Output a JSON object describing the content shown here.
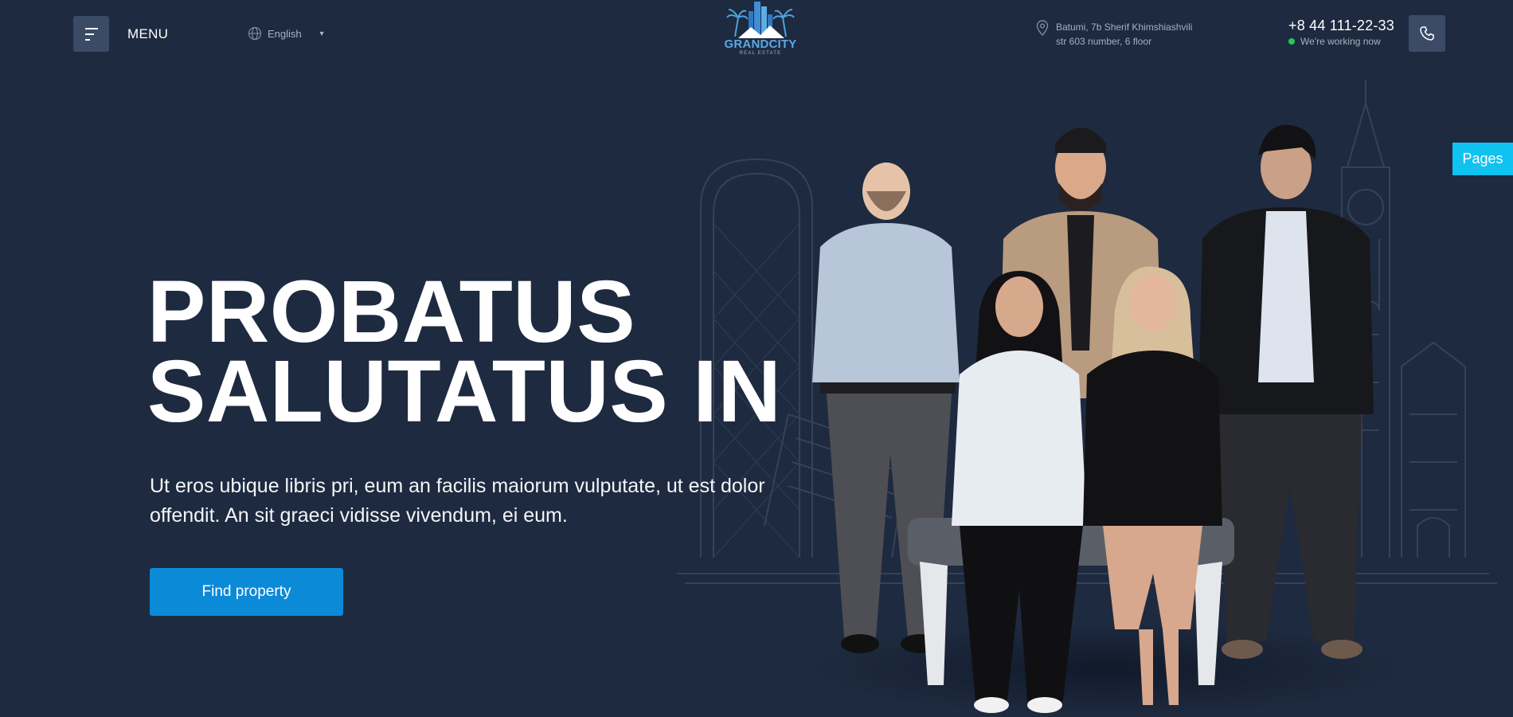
{
  "header": {
    "menu_label": "MENU",
    "language": "English",
    "logo": {
      "name": "GRANDCITY",
      "tagline": "REAL ESTATE"
    },
    "address": {
      "line1": "Batumi, 7b Sherif Khimshiashvili",
      "line2": "str 603 number, 6 floor"
    },
    "phone": {
      "number": "+8 44 111-22-33",
      "status": "We're working now"
    },
    "icons": {
      "menu": "hamburger-icon",
      "language": "globe-icon",
      "address": "location-pin-icon",
      "call": "phone-icon",
      "status": "online-dot"
    }
  },
  "side_tab": {
    "label": "Pages"
  },
  "hero": {
    "title_line1": "PROBATUS",
    "title_line2": "SALUTATUS IN",
    "description": "Ut eros ubique libris pri, eum an facilis maiorum vulputate, ut est dolor offendit. An sit graeci vidisse vivendum, ei eum.",
    "cta_label": "Find property"
  },
  "colors": {
    "background": "#1e2a3f",
    "button_dark": "#3b4b66",
    "accent_blue": "#0b8ad8",
    "tab_cyan": "#10c2f0",
    "status_green": "#1fcc5a"
  }
}
